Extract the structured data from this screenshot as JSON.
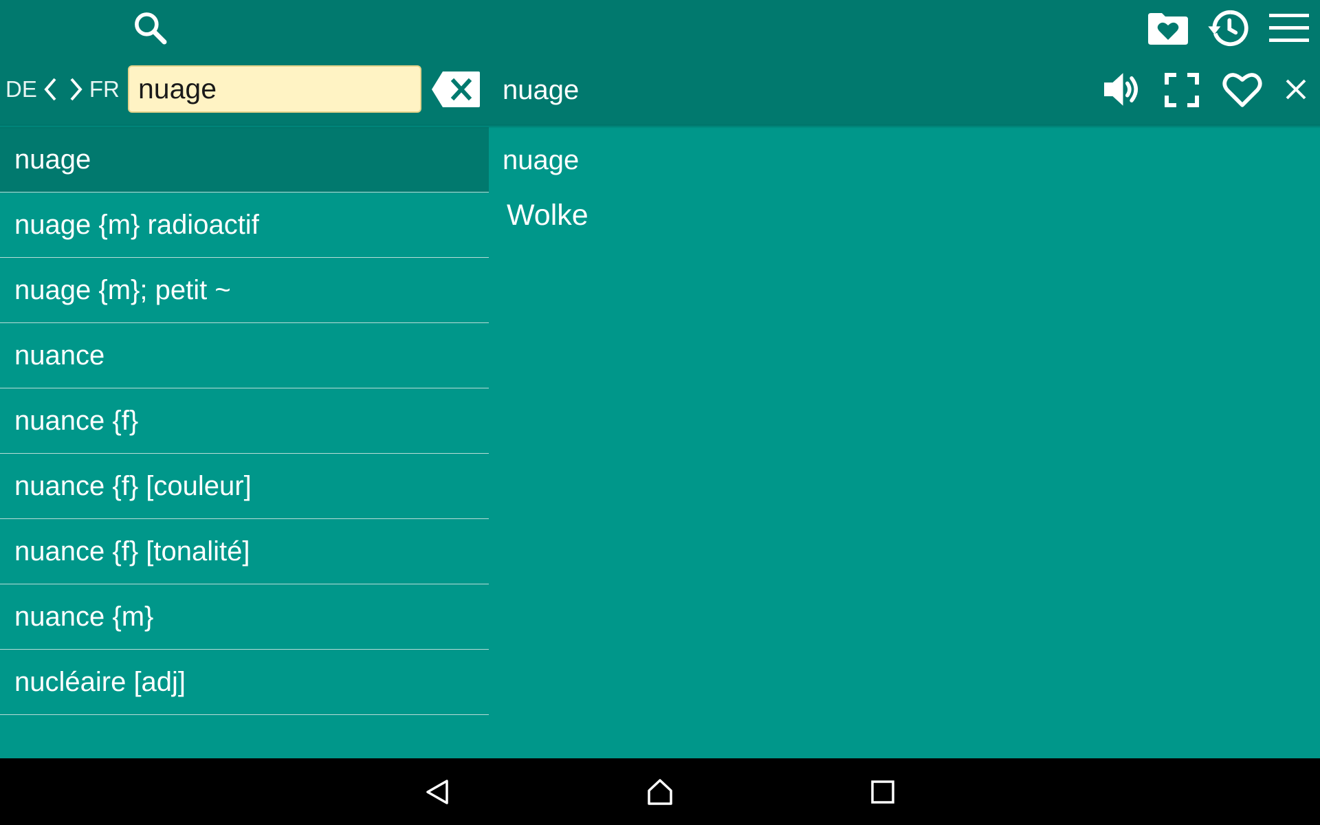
{
  "toolbar": {
    "search_icon": "search-icon",
    "favorites_folder_icon": "favorites-folder-icon",
    "history_icon": "history-icon",
    "menu_icon": "menu-icon"
  },
  "language": {
    "source": "DE",
    "target": "FR"
  },
  "search": {
    "value": "nuage",
    "clear_icon": "backspace-clear-icon"
  },
  "entry_header": {
    "word": "nuage",
    "actions": [
      "speaker-icon",
      "fullscreen-icon",
      "heart-icon",
      "close-icon"
    ]
  },
  "results": [
    "nuage",
    "nuage {m} radioactif",
    "nuage {m}; petit ~",
    "nuance",
    "nuance {f}",
    "nuance {f} [couleur]",
    "nuance {f} [tonalité]",
    "nuance {m}",
    "nucléaire [adj]"
  ],
  "selected_index": 0,
  "detail": {
    "headword": "nuage",
    "translation": "Wolke"
  },
  "colors": {
    "toolbar": "#01796e",
    "background": "#00978a",
    "search_field": "#fff3c4",
    "selected_row": "#01796e"
  },
  "navbar": {
    "buttons": [
      "back-icon",
      "home-icon",
      "recents-icon"
    ]
  }
}
